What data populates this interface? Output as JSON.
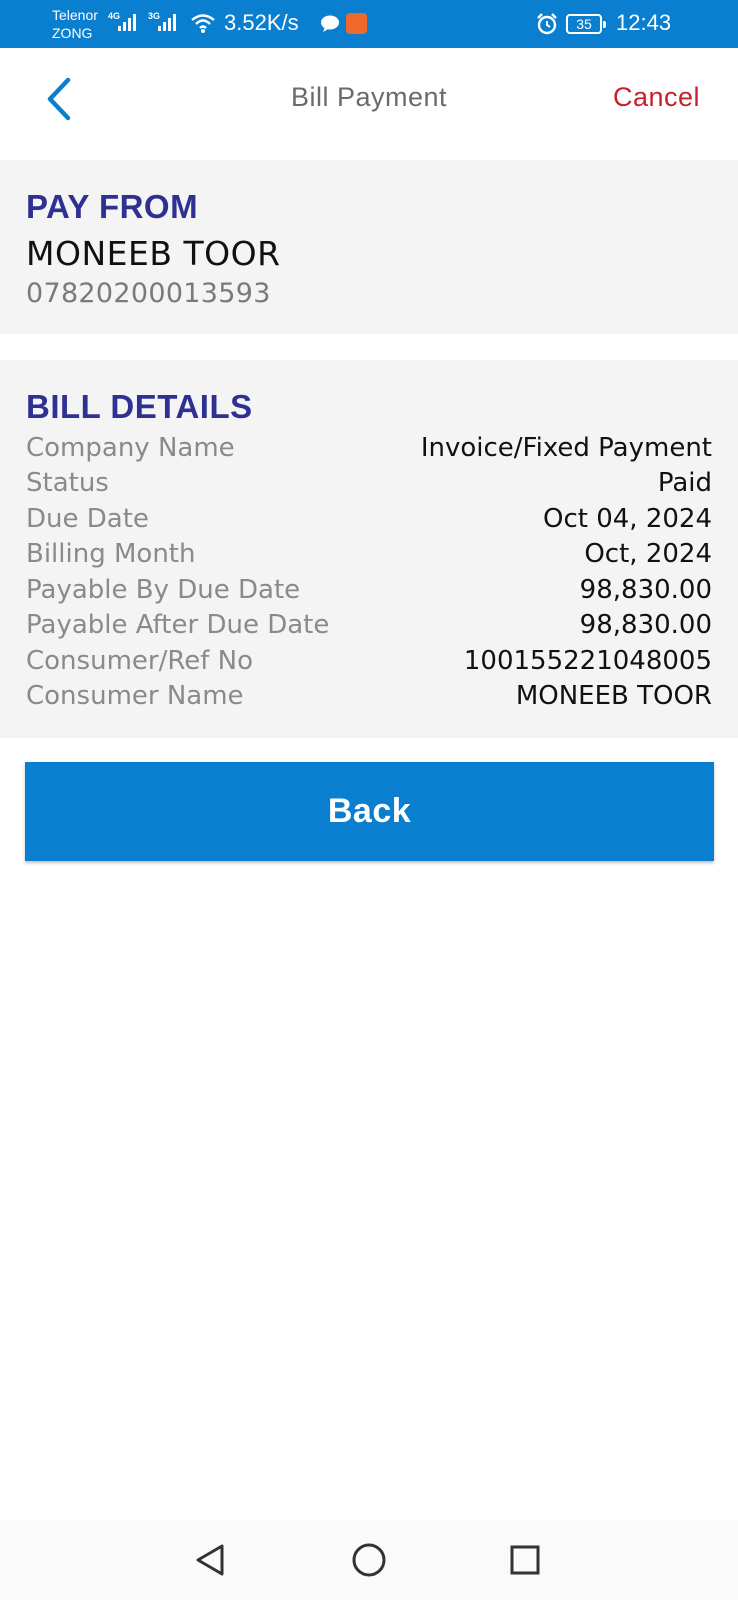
{
  "status_bar": {
    "carrier1": "Telenor",
    "carrier2": "ZONG",
    "network1": "4G",
    "network2": "3G",
    "speed": "3.52K/s",
    "battery": "35",
    "time": "12:43"
  },
  "header": {
    "title": "Bill Payment",
    "cancel_label": "Cancel"
  },
  "pay_from": {
    "title": "PAY FROM",
    "account_name": "MONEEB TOOR",
    "account_number": "07820200013593"
  },
  "bill_details": {
    "title": "BILL DETAILS",
    "rows": [
      {
        "label": "Company Name",
        "value": "Invoice/Fixed Payment"
      },
      {
        "label": "Status",
        "value": "Paid"
      },
      {
        "label": "Due Date",
        "value": "Oct 04, 2024"
      },
      {
        "label": "Billing Month",
        "value": "Oct, 2024"
      },
      {
        "label": "Payable By Due Date",
        "value": "98,830.00"
      },
      {
        "label": "Payable After Due Date",
        "value": "98,830.00"
      },
      {
        "label": "Consumer/Ref No",
        "value": "100155221048005"
      },
      {
        "label": "Consumer Name",
        "value": "MONEEB TOOR"
      }
    ]
  },
  "actions": {
    "back_label": "Back"
  },
  "colors": {
    "primary": "#0a7fcf",
    "heading": "#2e3191",
    "cancel": "#c8202a"
  },
  "icons": {
    "back": "chevron-left-icon",
    "nav_back": "triangle-back-icon",
    "nav_home": "circle-home-icon",
    "nav_recent": "square-recents-icon"
  }
}
